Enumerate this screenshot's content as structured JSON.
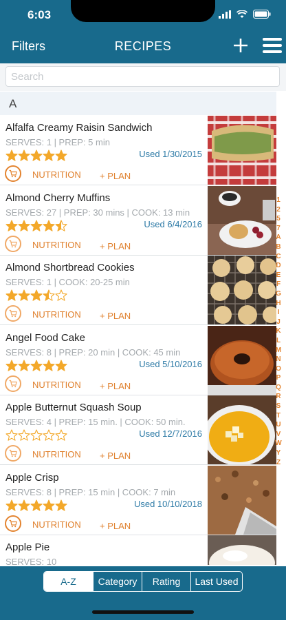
{
  "status_bar": {
    "time": "6:03"
  },
  "nav": {
    "filters_label": "Filters",
    "title": "RECIPES"
  },
  "search": {
    "placeholder": "Search"
  },
  "section_header": "A",
  "recipes": [
    {
      "name": "Alfalfa Creamy Raisin Sandwich",
      "meta": "SERVES: 1 | PREP: 5 min",
      "rating": 5,
      "used": "Used 1/30/2015",
      "nutrition_label": "NUTRITION",
      "plan_label": "+ PLAN",
      "cart_active": true,
      "image": "sandwich"
    },
    {
      "name": "Almond Cherry Muffins",
      "meta": "SERVES: 27 | PREP: 30 mins | COOK: 13 min",
      "rating": 4.5,
      "used": "Used 6/4/2016",
      "nutrition_label": "NUTRITION",
      "plan_label": "+ PLAN",
      "cart_active": false,
      "image": "muffins"
    },
    {
      "name": "Almond Shortbread Cookies",
      "meta": "SERVES: 1 | COOK: 20-25 min",
      "rating": 3.5,
      "used": "",
      "nutrition_label": "NUTRITION",
      "plan_label": "+ PLAN",
      "cart_active": false,
      "image": "cookies"
    },
    {
      "name": "Angel Food Cake",
      "meta": "SERVES: 8 | PREP: 20 min | COOK: 45 min",
      "rating": 5,
      "used": "Used 5/10/2016",
      "nutrition_label": "NUTRITION",
      "plan_label": "+ PLAN",
      "cart_active": false,
      "image": "cake"
    },
    {
      "name": "Apple Butternut Squash Soup",
      "meta": "SERVES: 4 | PREP: 15 min. | COOK: 50 min.",
      "rating": 0,
      "used": "Used 12/7/2016",
      "nutrition_label": "NUTRITION",
      "plan_label": "+ PLAN",
      "cart_active": false,
      "image": "soup"
    },
    {
      "name": "Apple Crisp",
      "meta": "SERVES: 8 | PREP: 15 min | COOK: 7 min",
      "rating": 5,
      "used": "Used 10/10/2018",
      "nutrition_label": "NUTRITION",
      "plan_label": "+ PLAN",
      "cart_active": true,
      "image": "crisp"
    },
    {
      "name": "Apple Pie",
      "meta": "SERVES: 10",
      "rating": 0,
      "used": "",
      "nutrition_label": "",
      "plan_label": "",
      "cart_active": false,
      "image": "pie"
    }
  ],
  "alphabet_index": [
    "1",
    "2",
    "5",
    "7",
    "A",
    "B",
    "C",
    "D",
    "E",
    "F",
    "G",
    "H",
    "I",
    "J",
    "K",
    "L",
    "M",
    "N",
    "O",
    "P",
    "Q",
    "R",
    "S",
    "T",
    "U",
    "V",
    "W",
    "Y",
    "Z"
  ],
  "sort_tabs": [
    "A-Z",
    "Category",
    "Rating",
    "Last Used"
  ],
  "selected_sort": "A-Z",
  "colors": {
    "brand": "#186a8c",
    "accent": "#e3832f",
    "star": "#f3a82a",
    "used_text": "#2d7aa6"
  }
}
